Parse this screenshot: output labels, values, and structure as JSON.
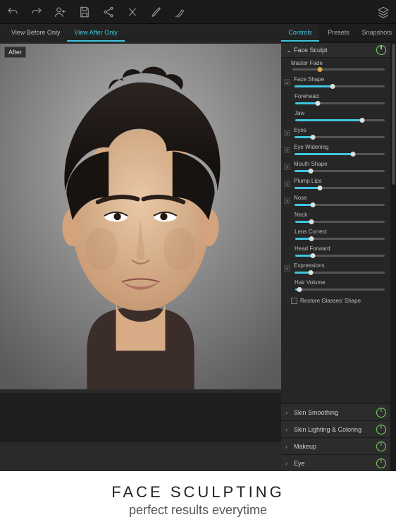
{
  "toolbar": {
    "icons": [
      "undo-icon",
      "redo-icon",
      "add-person-icon",
      "save-icon",
      "share-icon",
      "crop-icon",
      "brush-icon",
      "brush2-icon"
    ],
    "right_icons": [
      "layers-icon"
    ]
  },
  "view_tabs": {
    "before": "View Before Only",
    "after": "View After Only",
    "active": "after"
  },
  "badge_after": "After",
  "side_tabs": {
    "controls": "Controls",
    "presets": "Presets",
    "snapshots": "Snapshots",
    "active": "controls"
  },
  "face_sculpt": {
    "title": "Face Sculpt",
    "master_fade": {
      "label": "Master Fade",
      "value": 30
    },
    "sliders": [
      {
        "label": "Face Shape",
        "value": 42,
        "expand": true,
        "open": true
      },
      {
        "label": "Forehead",
        "value": 25,
        "expand": false
      },
      {
        "label": "Jaw",
        "value": 75,
        "expand": false
      },
      {
        "label": "Eyes",
        "value": 20,
        "expand": true
      },
      {
        "label": "Eye Widening",
        "value": 65,
        "expand": true
      },
      {
        "label": "Mouth Shape",
        "value": 18,
        "expand": true
      },
      {
        "label": "Plump Lips",
        "value": 28,
        "expand": true
      },
      {
        "label": "Nose",
        "value": 20,
        "expand": true
      },
      {
        "label": "Neck",
        "value": 18,
        "expand": false
      },
      {
        "label": "Lens Correct",
        "value": 18,
        "expand": false
      },
      {
        "label": "Head Forward",
        "value": 20,
        "expand": false
      },
      {
        "label": "Expressions",
        "value": 18,
        "expand": true
      },
      {
        "label": "Hair Volume",
        "value": 5,
        "expand": false
      }
    ],
    "restore_glasses": "Restore Glasses' Shape"
  },
  "sections": [
    {
      "label": "Skin Smoothing"
    },
    {
      "label": "Skin Lighting & Coloring"
    },
    {
      "label": "Makeup"
    },
    {
      "label": "Eye"
    }
  ],
  "marketing": {
    "title": "FACE SCULPTING",
    "subtitle": "perfect results everytime"
  },
  "colors": {
    "accent": "#3fc5e0",
    "power": "#7bd65c",
    "bg": "#262626"
  }
}
